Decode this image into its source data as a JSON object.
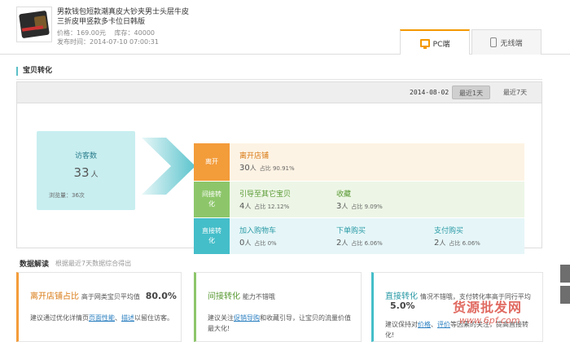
{
  "product": {
    "title": "男款钱包短款潮真皮大钞夹男士头层牛皮三折皮甲竖款多卡位日韩版",
    "price_label": "价格：169.00元",
    "stock_label": "库存：40000",
    "publish_label": "发布时间：2014-07-10 07:00:31"
  },
  "tabs": [
    {
      "label": "PC端",
      "active": true
    },
    {
      "label": "无线端",
      "active": false
    }
  ],
  "section_title": "宝贝转化",
  "panel": {
    "date": "2014-08-02",
    "range_buttons": [
      {
        "label": "最近1天",
        "active": true
      },
      {
        "label": "最近7天",
        "active": false
      }
    ]
  },
  "visitors": {
    "label": "访客数",
    "value": "33",
    "unit": "人",
    "pageviews": "浏览量：36次"
  },
  "rows": [
    {
      "label": "离开",
      "cells": [
        {
          "name": "离开店铺",
          "value": "30",
          "unit": "人",
          "ratio": "占比 90.91%"
        }
      ]
    },
    {
      "label": "间接转化",
      "cells": [
        {
          "name": "引导至其它宝贝",
          "value": "4",
          "unit": "人",
          "ratio": "占比 12.12%"
        },
        {
          "name": "收藏",
          "value": "3",
          "unit": "人",
          "ratio": "占比 9.09%"
        }
      ]
    },
    {
      "label": "直接转化",
      "cells": [
        {
          "name": "加入购物车",
          "value": "0",
          "unit": "人",
          "ratio": "占比 0%"
        },
        {
          "name": "下单购买",
          "value": "2",
          "unit": "人",
          "ratio": "占比 6.06%"
        },
        {
          "name": "支付购买",
          "value": "2",
          "unit": "人",
          "ratio": "占比 6.06%"
        }
      ]
    }
  ],
  "interpretation": {
    "title": "数据解读",
    "note": "根据最近7天数据综合得出",
    "cards": [
      {
        "key": "离开店铺占比",
        "desc": "高于网类宝贝平均值",
        "value": "80.0%",
        "body_pre": "建议通过优化详情页",
        "link1": "页面性能",
        "mid": "、",
        "link2": "描述",
        "body_post": "以留住访客。"
      },
      {
        "key": "间接转化",
        "desc": "能力不错哦",
        "body_pre": "建议关注",
        "link1": "促销导购",
        "body_post": "和收藏引导，让宝贝的流量价值最大化!"
      },
      {
        "key": "直接转化",
        "desc": "情况不错哦，支付转化率高于同行平均",
        "value": "5.0%",
        "body_pre": "建议保持对",
        "link1": "价格",
        "mid": "、",
        "link2": "评价",
        "body_post": "等因素的关注，提高直接转化!"
      }
    ]
  },
  "watermark": {
    "line1": "货源批发网",
    "line2": "www.6pf.com"
  },
  "colors": {
    "leave": "#f39c3a",
    "indirect": "#8dc66a",
    "direct": "#44bec9",
    "tab_accent": "#f39800"
  }
}
